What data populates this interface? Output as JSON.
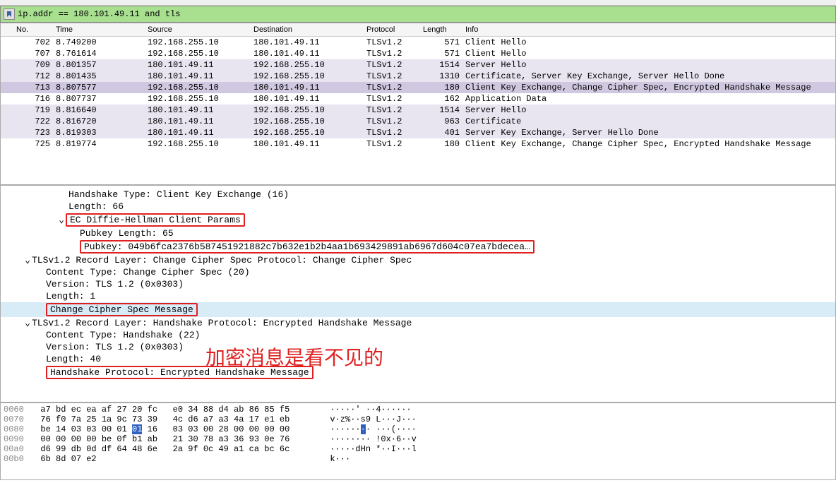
{
  "filter": {
    "text": "ip.addr == 180.101.49.11 and tls"
  },
  "columns": {
    "no": "No.",
    "time": "Time",
    "source": "Source",
    "destination": "Destination",
    "protocol": "Protocol",
    "length": "Length",
    "info": "Info"
  },
  "packets": [
    {
      "no": "702",
      "time": "8.749200",
      "src": "192.168.255.10",
      "dst": "180.101.49.11",
      "proto": "TLSv1.2",
      "len": "571",
      "info": "Client Hello",
      "cls": "normal"
    },
    {
      "no": "707",
      "time": "8.761614",
      "src": "192.168.255.10",
      "dst": "180.101.49.11",
      "proto": "TLSv1.2",
      "len": "571",
      "info": "Client Hello",
      "cls": "normal"
    },
    {
      "no": "709",
      "time": "8.801357",
      "src": "180.101.49.11",
      "dst": "192.168.255.10",
      "proto": "TLSv1.2",
      "len": "1514",
      "info": "Server Hello",
      "cls": "highlight"
    },
    {
      "no": "712",
      "time": "8.801435",
      "src": "180.101.49.11",
      "dst": "192.168.255.10",
      "proto": "TLSv1.2",
      "len": "1310",
      "info": "Certificate, Server Key Exchange, Server Hello Done",
      "cls": "highlight"
    },
    {
      "no": "713",
      "time": "8.807577",
      "src": "192.168.255.10",
      "dst": "180.101.49.11",
      "proto": "TLSv1.2",
      "len": "180",
      "info": "Client Key Exchange, Change Cipher Spec, Encrypted Handshake Message",
      "cls": "selected"
    },
    {
      "no": "716",
      "time": "8.807737",
      "src": "192.168.255.10",
      "dst": "180.101.49.11",
      "proto": "TLSv1.2",
      "len": "162",
      "info": "Application Data",
      "cls": "normal"
    },
    {
      "no": "719",
      "time": "8.816640",
      "src": "180.101.49.11",
      "dst": "192.168.255.10",
      "proto": "TLSv1.2",
      "len": "1514",
      "info": "Server Hello",
      "cls": "highlight"
    },
    {
      "no": "722",
      "time": "8.816720",
      "src": "180.101.49.11",
      "dst": "192.168.255.10",
      "proto": "TLSv1.2",
      "len": "963",
      "info": "Certificate",
      "cls": "highlight"
    },
    {
      "no": "723",
      "time": "8.819303",
      "src": "180.101.49.11",
      "dst": "192.168.255.10",
      "proto": "TLSv1.2",
      "len": "401",
      "info": "Server Key Exchange, Server Hello Done",
      "cls": "highlight"
    },
    {
      "no": "725",
      "time": "8.819774",
      "src": "192.168.255.10",
      "dst": "180.101.49.11",
      "proto": "TLSv1.2",
      "len": "180",
      "info": "Client Key Exchange, Change Cipher Spec, Encrypted Handshake Message",
      "cls": "normal"
    }
  ],
  "details": {
    "line0": "Handshake Type: Client Key Exchange (16)",
    "line1": "Length: 66",
    "line2": "EC Diffie-Hellman Client Params",
    "line3": "Pubkey Length: 65",
    "line4": "Pubkey: 049b6fca2376b587451921882c7b632e1b2b4aa1b693429891ab6967d604c07ea7bdecea…",
    "line5": "TLSv1.2 Record Layer: Change Cipher Spec Protocol: Change Cipher Spec",
    "line6": "Content Type: Change Cipher Spec (20)",
    "line7": "Version: TLS 1.2 (0x0303)",
    "line8": "Length: 1",
    "line9": "Change Cipher Spec Message",
    "line10": "TLSv1.2 Record Layer: Handshake Protocol: Encrypted Handshake Message",
    "line11": "Content Type: Handshake (22)",
    "line12": "Version: TLS 1.2 (0x0303)",
    "line13": "Length: 40",
    "line14": "Handshake Protocol: Encrypted Handshake Message"
  },
  "annotation": "加密消息是看不见的",
  "hex": [
    {
      "off": "0060",
      "b1": "a7 bd ec ea af 27 20 fc",
      "b2": "e0 34 88 d4 ab 86 85 f5",
      "asc": "·····' ··4······"
    },
    {
      "off": "0070",
      "b1": "76 f0 7a 25 1a 9c 73 39",
      "b2": "4c d6 a7 a3 4a 17 e1 eb",
      "asc": "v·z%··s9 L···J···"
    },
    {
      "off": "0080",
      "b1": "be 14 03 03 00 01 ",
      "bsel": "01",
      "b1b": " 16",
      "b2": "03 03 00 28 00 00 00 00",
      "asc": "······",
      "ascsel": "·",
      "ascb": "· ···(····"
    },
    {
      "off": "0090",
      "b1": "00 00 00 00 be 0f b1 ab",
      "b2": "21 30 78 a3 36 93 0e 76",
      "asc": "········ !0x·6··v"
    },
    {
      "off": "00a0",
      "b1": "d6 99 db 0d df 64 48 6e",
      "b2": "2a 9f 0c 49 a1 ca bc 6c",
      "asc": "·····dHn *··I···l"
    },
    {
      "off": "00b0",
      "b1": "6b 8d 07 e2",
      "b2": "",
      "asc": "k···"
    }
  ]
}
